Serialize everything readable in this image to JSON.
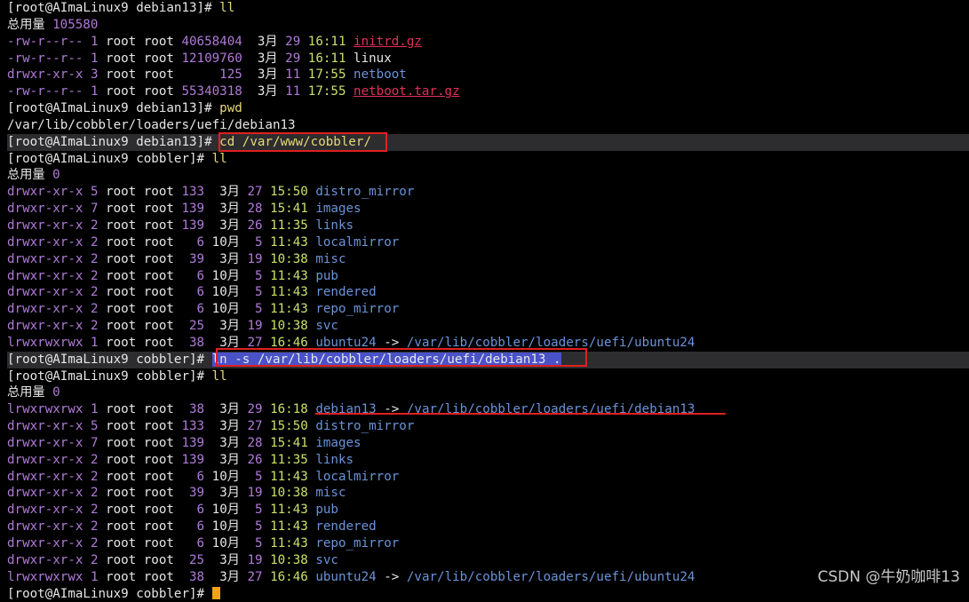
{
  "prompt1": "[root@AImaLinux9 debian13]#",
  "prompt2": "[root@AImaLinux9 cobbler]#",
  "cmd_ll": "ll",
  "cmd_pwd": "pwd",
  "cmd_cd": "cd /var/www/cobbler/",
  "cmd_ln": "ln -s /var/lib/cobbler/loaders/uefi/debian13 .",
  "total_label": "总用量",
  "total1": "105580",
  "total0": "0",
  "pwd_output": "/var/lib/cobbler/loaders/uefi/debian13",
  "owner": "root root",
  "block1": [
    {
      "perm": "-rw-r--r--",
      "links": "1",
      "size": "40658404",
      "month": "3月",
      "day": "29",
      "time": "16:11",
      "name": "initrd.gz",
      "kind": "arc"
    },
    {
      "perm": "-rw-r--r--",
      "links": "1",
      "size": "12109760",
      "month": "3月",
      "day": "29",
      "time": "16:11",
      "name": "linux",
      "kind": "white"
    },
    {
      "perm": "drwxr-xr-x",
      "links": "3",
      "size": "125",
      "month": "3月",
      "day": "11",
      "time": "17:55",
      "name": "netboot",
      "kind": "dir"
    },
    {
      "perm": "-rw-r--r--",
      "links": "1",
      "size": "55340318",
      "month": "3月",
      "day": "11",
      "time": "17:55",
      "name": "netboot.tar.gz",
      "kind": "arc"
    }
  ],
  "block2": [
    {
      "perm": "drwxr-xr-x",
      "links": "5",
      "size": "133",
      "month": "3月",
      "day": "27",
      "time": "15:50",
      "name": "distro_mirror"
    },
    {
      "perm": "drwxr-xr-x",
      "links": "7",
      "size": "139",
      "month": "3月",
      "day": "28",
      "time": "15:41",
      "name": "images"
    },
    {
      "perm": "drwxr-xr-x",
      "links": "2",
      "size": "139",
      "month": "3月",
      "day": "26",
      "time": "11:35",
      "name": "links"
    },
    {
      "perm": "drwxr-xr-x",
      "links": "2",
      "size": "6",
      "month": "10月",
      "day": "5",
      "time": "11:43",
      "name": "localmirror"
    },
    {
      "perm": "drwxr-xr-x",
      "links": "2",
      "size": "39",
      "month": "3月",
      "day": "19",
      "time": "10:38",
      "name": "misc"
    },
    {
      "perm": "drwxr-xr-x",
      "links": "2",
      "size": "6",
      "month": "10月",
      "day": "5",
      "time": "11:43",
      "name": "pub"
    },
    {
      "perm": "drwxr-xr-x",
      "links": "2",
      "size": "6",
      "month": "10月",
      "day": "5",
      "time": "11:43",
      "name": "rendered"
    },
    {
      "perm": "drwxr-xr-x",
      "links": "2",
      "size": "6",
      "month": "10月",
      "day": "5",
      "time": "11:43",
      "name": "repo_mirror"
    },
    {
      "perm": "drwxr-xr-x",
      "links": "2",
      "size": "25",
      "month": "3月",
      "day": "19",
      "time": "10:38",
      "name": "svc"
    },
    {
      "perm": "lrwxrwxrwx",
      "links": "1",
      "size": "38",
      "month": "3月",
      "day": "27",
      "time": "16:46",
      "name": "ubuntu24",
      "target": "/var/lib/cobbler/loaders/uefi/ubuntu24"
    }
  ],
  "block3": [
    {
      "perm": "lrwxrwxrwx",
      "links": "1",
      "size": "38",
      "month": "3月",
      "day": "29",
      "time": "16:18",
      "name": "debian13",
      "target": "/var/lib/cobbler/loaders/uefi/debian13"
    },
    {
      "perm": "drwxr-xr-x",
      "links": "5",
      "size": "133",
      "month": "3月",
      "day": "27",
      "time": "15:50",
      "name": "distro_mirror"
    },
    {
      "perm": "drwxr-xr-x",
      "links": "7",
      "size": "139",
      "month": "3月",
      "day": "28",
      "time": "15:41",
      "name": "images"
    },
    {
      "perm": "drwxr-xr-x",
      "links": "2",
      "size": "139",
      "month": "3月",
      "day": "26",
      "time": "11:35",
      "name": "links"
    },
    {
      "perm": "drwxr-xr-x",
      "links": "2",
      "size": "6",
      "month": "10月",
      "day": "5",
      "time": "11:43",
      "name": "localmirror"
    },
    {
      "perm": "drwxr-xr-x",
      "links": "2",
      "size": "39",
      "month": "3月",
      "day": "19",
      "time": "10:38",
      "name": "misc"
    },
    {
      "perm": "drwxr-xr-x",
      "links": "2",
      "size": "6",
      "month": "10月",
      "day": "5",
      "time": "11:43",
      "name": "pub"
    },
    {
      "perm": "drwxr-xr-x",
      "links": "2",
      "size": "6",
      "month": "10月",
      "day": "5",
      "time": "11:43",
      "name": "rendered"
    },
    {
      "perm": "drwxr-xr-x",
      "links": "2",
      "size": "6",
      "month": "10月",
      "day": "5",
      "time": "11:43",
      "name": "repo_mirror"
    },
    {
      "perm": "drwxr-xr-x",
      "links": "2",
      "size": "25",
      "month": "3月",
      "day": "19",
      "time": "10:38",
      "name": "svc"
    },
    {
      "perm": "lrwxrwxrwx",
      "links": "1",
      "size": "38",
      "month": "3月",
      "day": "27",
      "time": "16:46",
      "name": "ubuntu24",
      "target": "/var/lib/cobbler/loaders/uefi/ubuntu24"
    }
  ],
  "arrow": "->",
  "watermark": "CSDN @牛奶咖啡13",
  "colors": {
    "perm": "#b07ad8",
    "time": "#c9e06a",
    "dir": "#6a93d8",
    "archive": "#e0305a",
    "command": "#e8d878",
    "annotation": "#e02020",
    "cursor": "#f4a11a"
  }
}
